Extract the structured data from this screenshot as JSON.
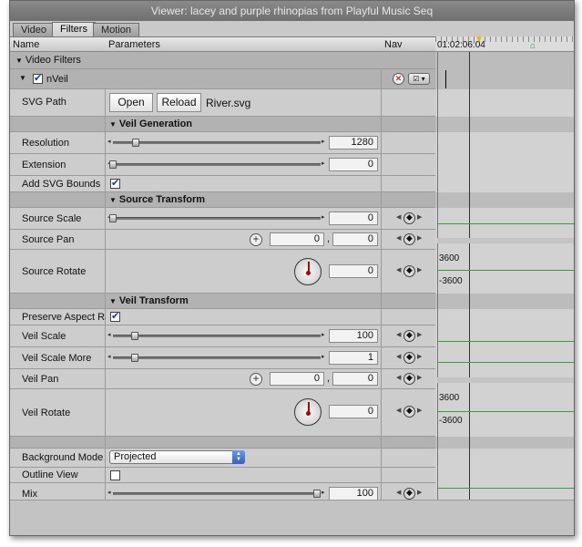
{
  "window": {
    "title": "Viewer: lacey and purple rhinopias from Playful Music Seq"
  },
  "tabs": [
    {
      "label": "Video"
    },
    {
      "label": "Filters"
    },
    {
      "label": "Motion"
    }
  ],
  "columns": {
    "name": "Name",
    "parameters": "Parameters",
    "nav": "Nav"
  },
  "timeline": {
    "timecode": "01:02:06:04",
    "rotate_max": "3600",
    "rotate_min": "-3600"
  },
  "video_filters_label": "Video Filters",
  "filter": {
    "name": "nVeil",
    "enabled": true
  },
  "svg_path": {
    "label": "SVG Path",
    "open_label": "Open",
    "reload_label": "Reload",
    "file": "River.svg"
  },
  "sections": {
    "veil_generation": "Veil Generation",
    "source_transform": "Source Transform",
    "veil_transform": "Veil Transform"
  },
  "params": {
    "resolution": {
      "label": "Resolution",
      "value": "1280",
      "level": 0.1
    },
    "extension": {
      "label": "Extension",
      "value": "0",
      "level": 0.0
    },
    "add_svg_bounds": {
      "label": "Add SVG Bounds",
      "checked": true
    },
    "source_scale": {
      "label": "Source Scale",
      "value": "0",
      "level": 0.0
    },
    "source_pan": {
      "label": "Source Pan",
      "x": "0",
      "y": "0"
    },
    "source_rotate": {
      "label": "Source Rotate",
      "value": "0"
    },
    "preserve_aspect": {
      "label": "Preserve Aspect Rati",
      "checked": true
    },
    "veil_scale": {
      "label": "Veil Scale",
      "value": "100",
      "level": 0.1
    },
    "veil_scale_more": {
      "label": "Veil Scale More",
      "value": "1",
      "level": 0.1
    },
    "veil_pan": {
      "label": "Veil Pan",
      "x": "0",
      "y": "0"
    },
    "veil_rotate": {
      "label": "Veil Rotate",
      "value": "0"
    },
    "background_mode": {
      "label": "Background Mode",
      "selected": "Projected"
    },
    "outline_view": {
      "label": "Outline View",
      "checked": false
    },
    "mix": {
      "label": "Mix",
      "value": "100",
      "level": 1.0
    }
  },
  "colors": {
    "keyframe_line": "#3a9d3a",
    "dial_needle": "#b00000",
    "select_accent": "#2f61c7"
  }
}
